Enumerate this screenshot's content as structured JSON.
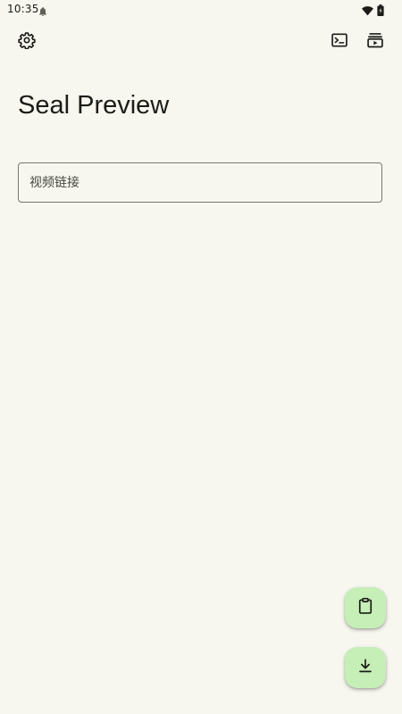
{
  "status_bar": {
    "time": "10:35",
    "notification_icon": "notification-bell-icon",
    "wifi_icon": "wifi-icon",
    "battery_icon": "battery-icon"
  },
  "top_bar": {
    "settings_icon": "gear-icon",
    "terminal_icon": "terminal-icon",
    "queue_icon": "playlist-play-icon"
  },
  "title": "Seal Preview",
  "url_input": {
    "placeholder": "视频链接",
    "value": ""
  },
  "fabs": {
    "paste_icon": "clipboard-icon",
    "download_icon": "download-icon"
  },
  "colors": {
    "background": "#f7f7f0",
    "fab_background": "#c6efb7",
    "text": "#1b1c17",
    "outline": "#75786c"
  }
}
